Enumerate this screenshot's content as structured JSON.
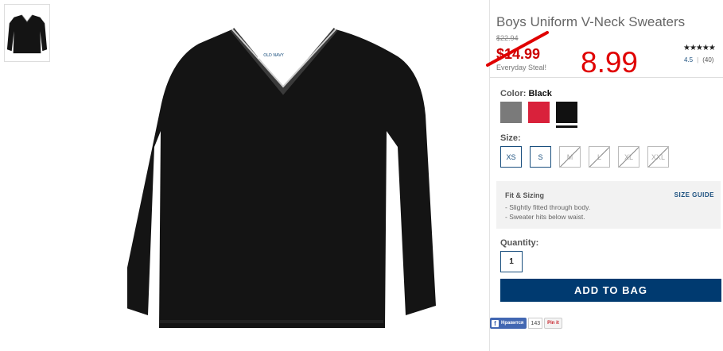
{
  "product": {
    "title": "Boys Uniform V-Neck Sweaters",
    "original_price": "$22.94",
    "sale_price": "$14.99",
    "promo_text": "Everyday Steal!",
    "handwritten_new_price": "8.99"
  },
  "rating": {
    "stars": "★★★★★",
    "score": "4.5",
    "separator": "|",
    "review_count": "(40)"
  },
  "color": {
    "label": "Color:",
    "selected_name": "Black",
    "swatches": [
      {
        "name": "Gray",
        "hex": "#7a7a7a"
      },
      {
        "name": "Red",
        "hex": "#d9213b"
      },
      {
        "name": "Black",
        "hex": "#111111"
      }
    ]
  },
  "size": {
    "label": "Size:",
    "options": [
      {
        "label": "XS",
        "available": true
      },
      {
        "label": "S",
        "available": true
      },
      {
        "label": "M",
        "available": false
      },
      {
        "label": "L",
        "available": false
      },
      {
        "label": "XL",
        "available": false
      },
      {
        "label": "XXL",
        "available": false
      }
    ]
  },
  "fit": {
    "title": "Fit & Sizing",
    "size_guide_label": "SIZE GUIDE",
    "lines": [
      "- Slightly fitted through body.",
      "- Sweater hits below waist."
    ]
  },
  "quantity": {
    "label": "Quantity:",
    "value": "1"
  },
  "add_to_bag_label": "ADD TO BAG",
  "social": {
    "facebook_label": "Нравится",
    "facebook_count": "143",
    "pinterest_label": "Pin it"
  },
  "brand_label_on_garment": "OLD NAVY",
  "colors": {
    "accent_blue": "#1a4f7e",
    "button_navy": "#003a70",
    "sale_red": "#cc0000",
    "annotation_red": "#e00000"
  }
}
